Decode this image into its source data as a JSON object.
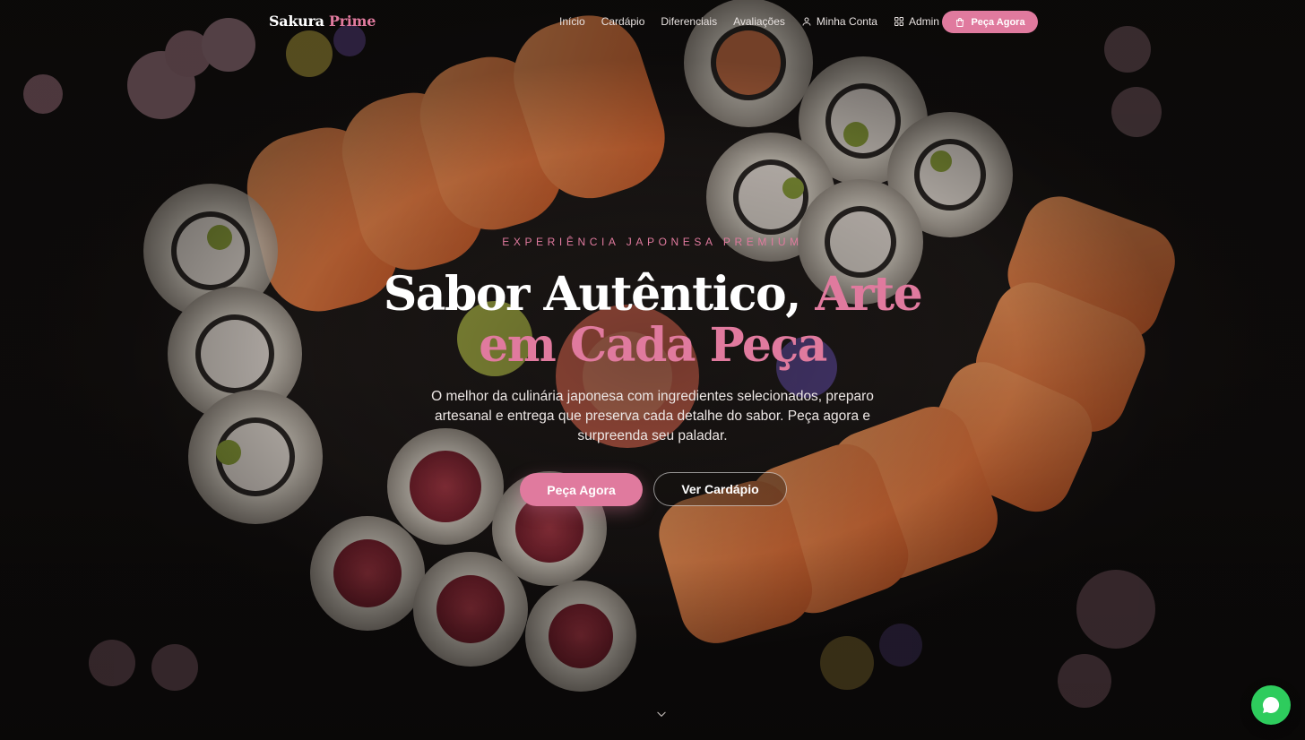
{
  "brand": {
    "part1": "Sakura",
    "part2": "Prime"
  },
  "nav": {
    "links": [
      "Início",
      "Cardápio",
      "Diferenciais",
      "Avaliações"
    ],
    "account": "Minha Conta",
    "admin": "Admin",
    "cta": "Peça Agora"
  },
  "hero": {
    "eyebrow": "EXPERIÊNCIA JAPONESA PREMIUM",
    "title_white": "Sabor Autêntico, ",
    "title_pink": "Arte em Cada Peça",
    "lead": "O melhor da culinária japonesa com ingredientes selecionados, preparo artesanal e entrega que preserva cada detalhe do sabor. Peça agora e surpreenda seu paladar.",
    "primary_button": "Peça Agora",
    "secondary_button": "Ver Cardápio"
  },
  "icons": {
    "account": "user-icon",
    "admin": "grid-icon",
    "cta": "shopping-bag-icon",
    "scroll": "chevron-down-icon",
    "chat": "whatsapp-icon"
  },
  "colors": {
    "accent": "#e07a9e",
    "whatsapp": "#2ecc5d",
    "background": "#141110"
  }
}
